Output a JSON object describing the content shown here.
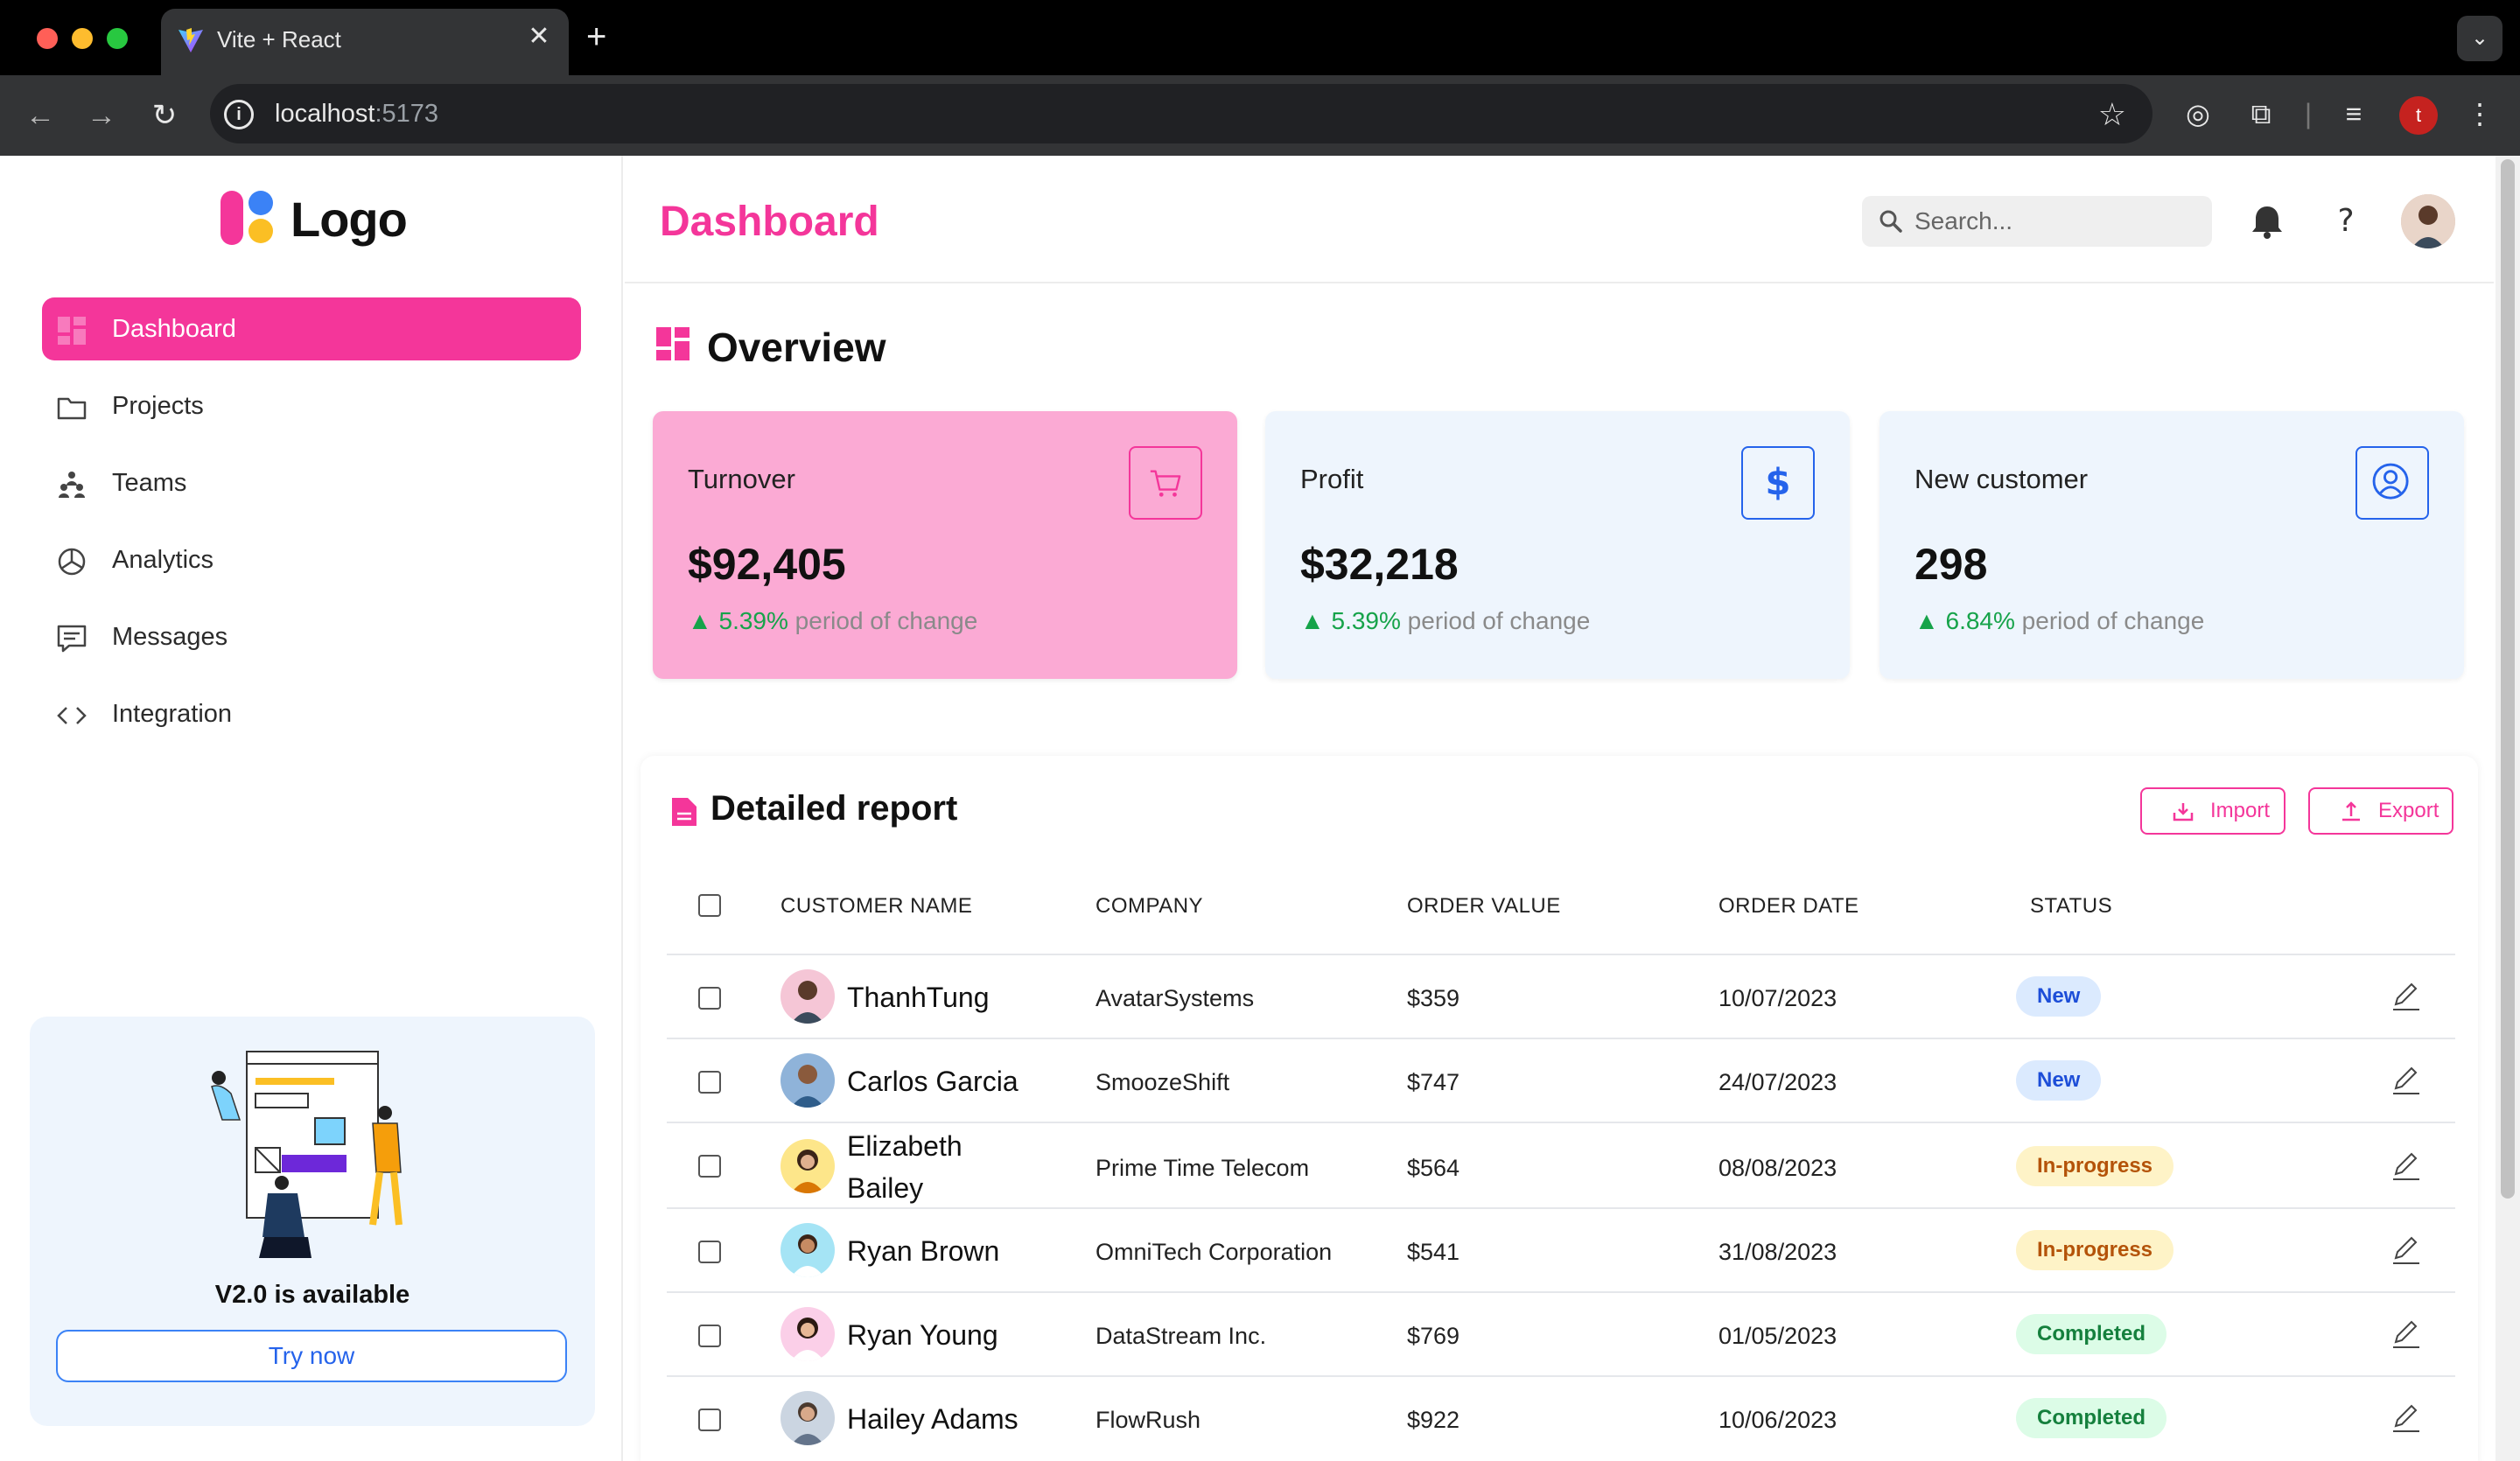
{
  "browser": {
    "tab_title": "Vite + React",
    "url_host": "localhost",
    "url_port": ":5173",
    "profile_initial": "t"
  },
  "sidebar": {
    "logo_text": "Logo",
    "items": [
      {
        "label": "Dashboard",
        "icon": "dashboard-icon"
      },
      {
        "label": "Projects",
        "icon": "folder-icon"
      },
      {
        "label": "Teams",
        "icon": "teams-icon"
      },
      {
        "label": "Analytics",
        "icon": "pie-chart-icon"
      },
      {
        "label": "Messages",
        "icon": "message-icon"
      },
      {
        "label": "Integration",
        "icon": "code-icon"
      }
    ],
    "promo": {
      "title": "V2.0 is available",
      "button": "Try now"
    }
  },
  "header": {
    "title": "Dashboard",
    "search_placeholder": "Search..."
  },
  "overview": {
    "title": "Overview",
    "cards": [
      {
        "label": "Turnover",
        "value": "$92,405",
        "change_pct": "5.39%",
        "change_text": " period of change",
        "icon": "cart-icon"
      },
      {
        "label": "Profit",
        "value": "$32,218",
        "change_pct": "5.39%",
        "change_text": " period of change",
        "icon": "dollar-icon"
      },
      {
        "label": "New customer",
        "value": "298",
        "change_pct": "6.84%",
        "change_text": " period of change",
        "icon": "user-circle-icon"
      }
    ]
  },
  "report": {
    "title": "Detailed report",
    "import_label": "Import",
    "export_label": "Export",
    "columns": [
      "CUSTOMER NAME",
      "COMPANY",
      "ORDER VALUE",
      "ORDER DATE",
      "STATUS"
    ],
    "rows": [
      {
        "name": "ThanhTung",
        "company": "AvatarSystems",
        "value": "$359",
        "date": "10/07/2023",
        "status": "New"
      },
      {
        "name": "Carlos Garcia",
        "company": "SmoozeShift",
        "value": "$747",
        "date": "24/07/2023",
        "status": "New"
      },
      {
        "name": "Elizabeth Bailey",
        "company": "Prime Time Telecom",
        "value": "$564",
        "date": "08/08/2023",
        "status": "In-progress"
      },
      {
        "name": "Ryan Brown",
        "company": "OmniTech Corporation",
        "value": "$541",
        "date": "31/08/2023",
        "status": "In-progress"
      },
      {
        "name": "Ryan Young",
        "company": "DataStream Inc.",
        "value": "$769",
        "date": "01/05/2023",
        "status": "Completed"
      },
      {
        "name": "Hailey Adams",
        "company": "FlowRush",
        "value": "$922",
        "date": "10/06/2023",
        "status": "Completed"
      }
    ]
  },
  "colors": {
    "accent": "#f4369a",
    "turnover_card": "#fbaad4",
    "card_bg": "#eef5fd",
    "blue": "#2563eb"
  }
}
